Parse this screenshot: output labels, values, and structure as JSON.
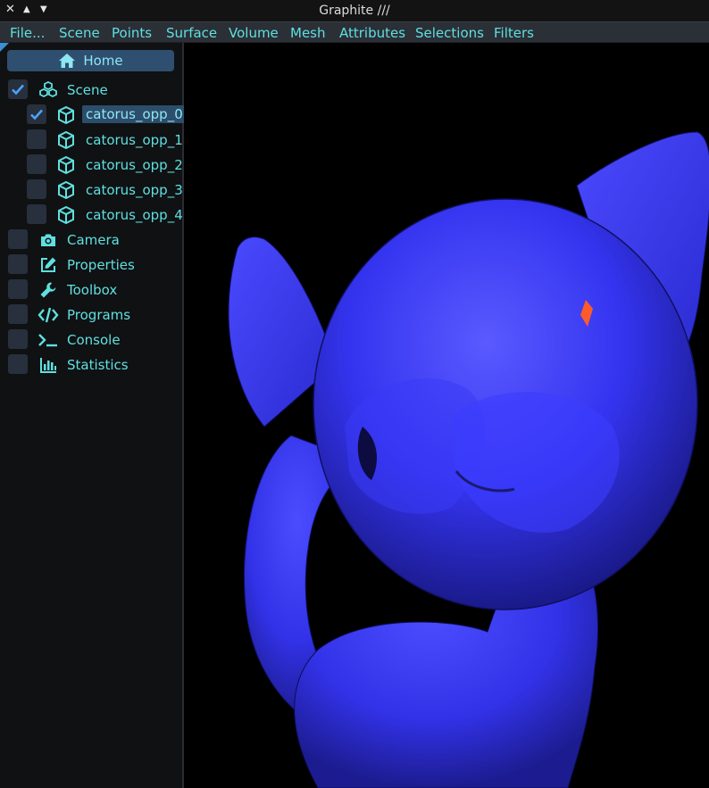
{
  "window": {
    "title": "Graphite ///"
  },
  "menubar": {
    "items": [
      "File...",
      "Scene",
      "Points",
      "Surface",
      "Volume",
      "Mesh",
      "Attributes",
      "Selections",
      "Filters"
    ]
  },
  "sidebar": {
    "home_label": "Home",
    "scene": {
      "label": "Scene",
      "checked": true
    },
    "objects": [
      {
        "label": "catorus_opp_0",
        "checked": true,
        "selected": true
      },
      {
        "label": "catorus_opp_1",
        "checked": false,
        "selected": false
      },
      {
        "label": "catorus_opp_2",
        "checked": false,
        "selected": false
      },
      {
        "label": "catorus_opp_3",
        "checked": false,
        "selected": false
      },
      {
        "label": "catorus_opp_4",
        "checked": false,
        "selected": false
      }
    ],
    "tools": [
      {
        "label": "Camera",
        "icon": "camera-icon"
      },
      {
        "label": "Properties",
        "icon": "edit-icon"
      },
      {
        "label": "Toolbox",
        "icon": "wrench-icon"
      },
      {
        "label": "Programs",
        "icon": "code-icon"
      },
      {
        "label": "Console",
        "icon": "terminal-icon"
      },
      {
        "label": "Statistics",
        "icon": "chart-icon"
      }
    ]
  },
  "viewport": {
    "model_color": "#3a3af2",
    "highlight_color": "#ff5a2a",
    "background": "#000000"
  },
  "colors": {
    "accent": "#5fe0e0",
    "selection": "#2c4d6b",
    "check": "#4aa3ff"
  }
}
